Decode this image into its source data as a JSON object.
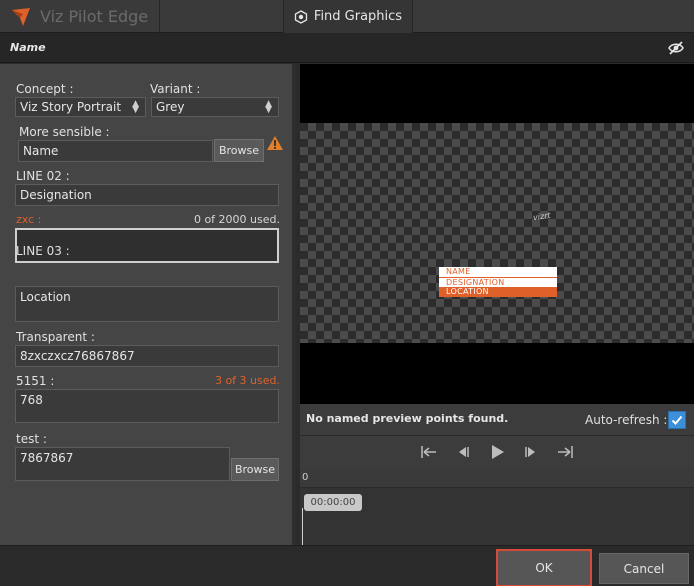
{
  "app": {
    "name": "Viz Pilot Edge",
    "find_tab": "Find Graphics"
  },
  "template": {
    "title": "Name"
  },
  "form": {
    "concept": {
      "label": "Concept :",
      "value": "Viz Story Portrait"
    },
    "variant": {
      "label": "Variant :",
      "value": "Grey"
    },
    "more_sensible": {
      "label": "More sensible :",
      "value": "Name",
      "browse": "Browse"
    },
    "line02": {
      "label": "LINE 02 :",
      "value": "Designation"
    },
    "zxc": {
      "label": "zxc :",
      "counter": "0 of 2000 used.",
      "value": ""
    },
    "line03": {
      "label": "LINE 03 :",
      "value": "Location"
    },
    "transparent": {
      "label": "Transparent :",
      "value": "8zxczxcz76867867"
    },
    "f5151": {
      "label": "5151 :",
      "counter": "3 of 3 used.",
      "value": "768"
    },
    "test": {
      "label": "test :",
      "value": "7867867",
      "browse": "Browse"
    }
  },
  "preview": {
    "lower_third": {
      "name": "NAME",
      "designation": "DESIGNATION",
      "location": "LOCATION"
    },
    "watermark": "vizrt",
    "message": "No named preview points found.",
    "auto_refresh_label": "Auto-refresh :",
    "auto_refresh_checked": true
  },
  "timeline": {
    "ruler_start": "0",
    "timecode": "00:00:00"
  },
  "footer": {
    "ok": "OK",
    "cancel": "Cancel"
  },
  "colors": {
    "accent": "#e0602a",
    "checkbox": "#3d8fd9",
    "ok_border": "#d64a3a"
  }
}
